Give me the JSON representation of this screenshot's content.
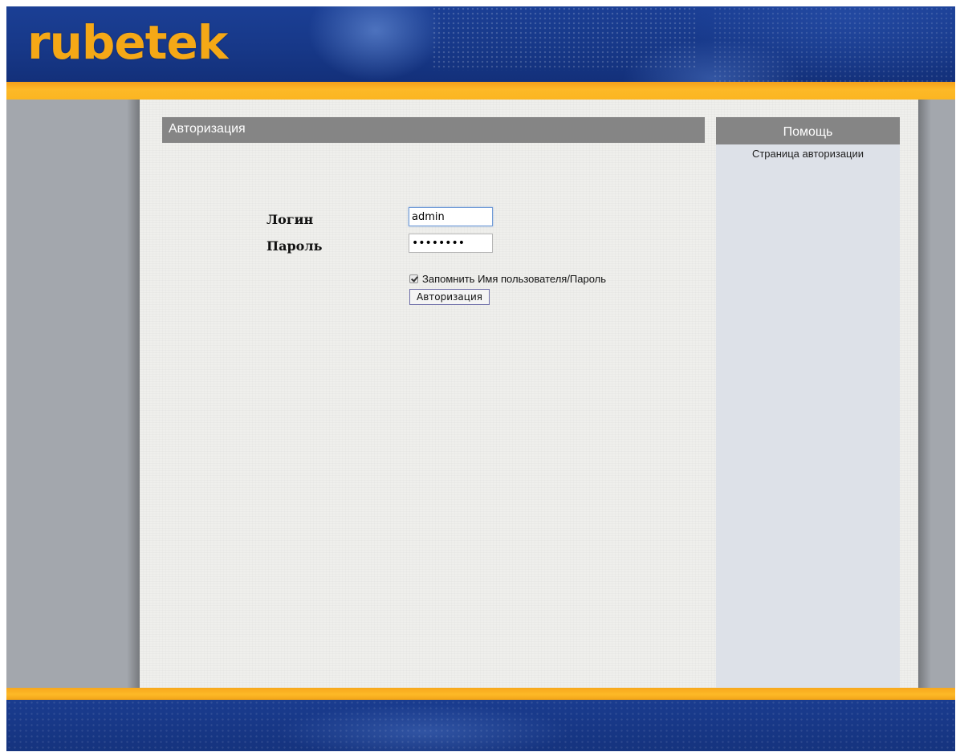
{
  "brand": {
    "logo_text": "rubetek",
    "accent_color": "#f5a816",
    "header_color": "#1b3f95"
  },
  "main": {
    "section_title": "Авторизация",
    "login": {
      "label": "Логин",
      "value": "admin"
    },
    "password": {
      "label": "Пароль",
      "value": "12345678"
    },
    "remember": {
      "label": "Запомнить Имя пользователя/Пароль",
      "checked": true
    },
    "submit_label": "Авторизация"
  },
  "help": {
    "title": "Помощь",
    "text": "Страница авторизации"
  }
}
